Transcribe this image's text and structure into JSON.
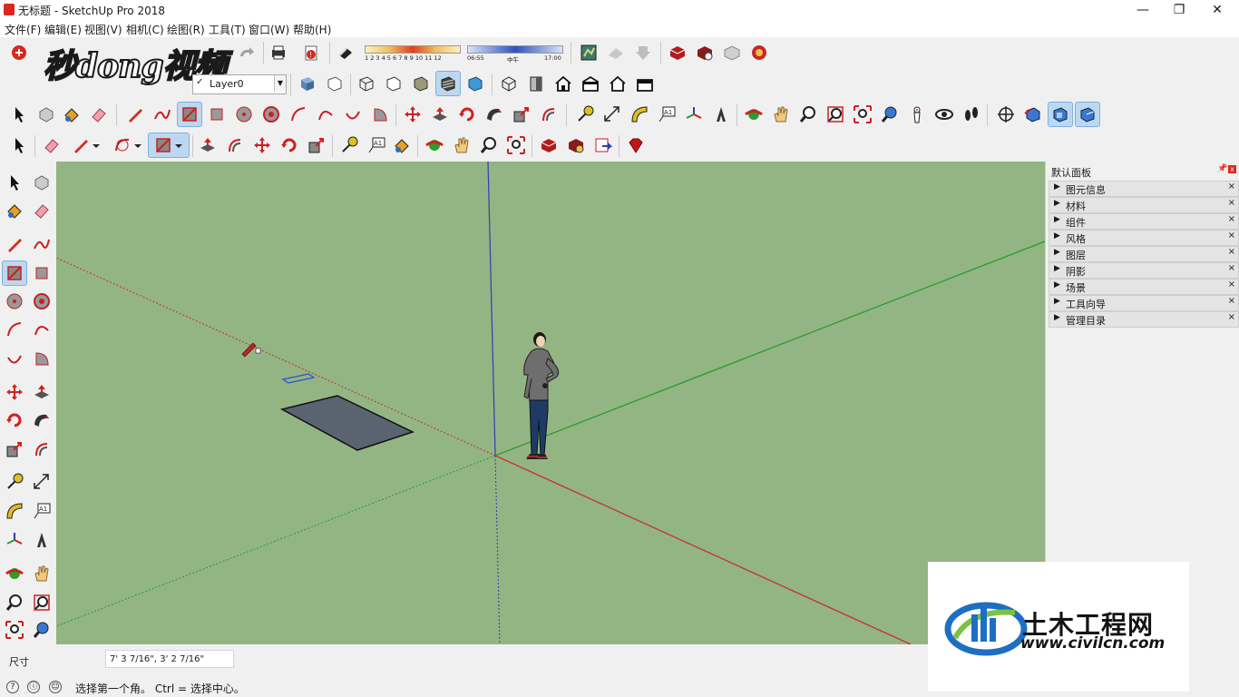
{
  "window": {
    "title": "无标题 - SketchUp Pro 2018",
    "minimize": "—",
    "maximize": "❐",
    "close": "✕"
  },
  "menubar": [
    "文件(F)",
    "编辑(E)",
    "视图(V)",
    "相机(C)",
    "绘图(R)",
    "工具(T)",
    "窗口(W)",
    "帮助(H)"
  ],
  "watermark": "秒dong视频",
  "layer": {
    "current": "Layer0",
    "check": "✓"
  },
  "shadow_time": {
    "months": "1 2 3 4 5 6 7 8 9 10 11 12",
    "start": "06:55",
    "mid": "中午",
    "end": "17:00"
  },
  "toolbars": {
    "row1": [
      "select-tool",
      "layer-manager",
      "paint-bucket",
      "eraser",
      "line-tool",
      "freehand",
      "rectangle",
      "rotated-rectangle",
      "circle",
      "polygon",
      "arc",
      "two-point-arc",
      "three-point-arc",
      "pie",
      "move",
      "push-pull",
      "rotate",
      "follow-me",
      "scale",
      "offset",
      "tape-measure",
      "dimensions",
      "protractor",
      "text",
      "axes",
      "3d-text",
      "orbit",
      "pan",
      "zoom",
      "zoom-window",
      "zoom-extents",
      "previous-view",
      "position-camera",
      "look-around",
      "walk",
      "section-plane",
      "display-section-planes",
      "display-section-cuts",
      "section-fill"
    ],
    "row2": [
      "select-tool",
      "eraser",
      "line-tool",
      "arc",
      "rectangle",
      "push-pull",
      "follow-me",
      "move",
      "rotate",
      "scale",
      "tape-measure",
      "text",
      "paint-bucket",
      "orbit",
      "pan",
      "zoom",
      "zoom-extents",
      "3d-warehouse",
      "extension-warehouse",
      "send-to-layout",
      "ruby-console"
    ]
  },
  "viewport": {
    "background": "#93b584",
    "axis_colors": {
      "red": "#c8302a",
      "green": "#2d9b2d",
      "blue": "#2c3fb4"
    }
  },
  "tray": {
    "title": "默认面板",
    "pin": "📌",
    "close": "x",
    "panels": [
      "图元信息",
      "材料",
      "组件",
      "风格",
      "图层",
      "阴影",
      "场景",
      "工具向导",
      "管理目录"
    ],
    "panel_close": "×",
    "panel_arrow": "▶"
  },
  "measurements": {
    "label": "尺寸",
    "value": "7' 3 7/16\", 3' 2 7/16\""
  },
  "status": {
    "text": "选择第一个角。 Ctrl = 选择中心。",
    "icons": [
      "?",
      "ⓘ",
      "☺"
    ]
  },
  "logo": {
    "cn": "土木工程网",
    "url": "www.civilcn.com"
  }
}
